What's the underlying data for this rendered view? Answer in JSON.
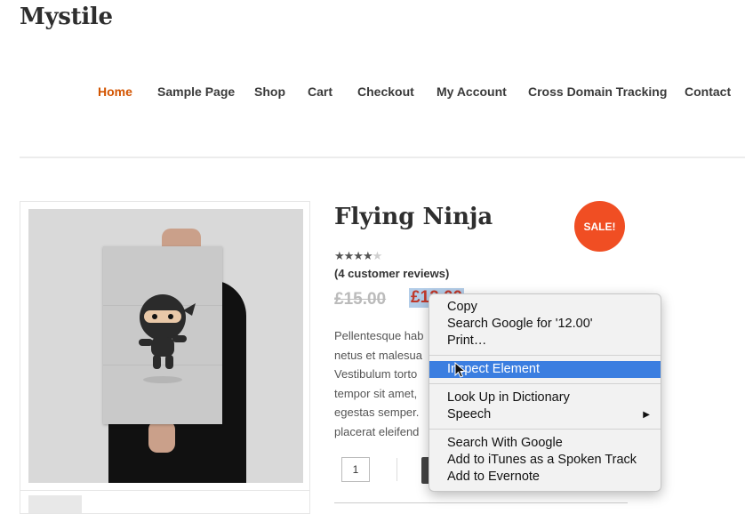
{
  "site": {
    "logo": "Mystile"
  },
  "nav": {
    "items": [
      "Home",
      "Sample Page",
      "Shop",
      "Cart",
      "Checkout",
      "My Account",
      "Cross Domain Tracking",
      "Contact"
    ],
    "active_index": 0
  },
  "product": {
    "title": "Flying Ninja",
    "sale_badge": "SALE!",
    "rating_out_of_5": 4,
    "reviews": "(4 customer reviews)",
    "old_price": "£15.00",
    "new_price": "£12.00",
    "description_lines": [
      "Pellentesque hab",
      "netus et malesua",
      "Vestibulum torto",
      "tempor sit amet,",
      "egestas semper.",
      "placerat eleifend"
    ],
    "quantity": "1"
  },
  "context_menu": {
    "items": [
      "Copy",
      "Search Google for '12.00'",
      "Print…",
      "Inspect Element",
      "Look Up in Dictionary",
      "Speech",
      "Search With Google",
      "Add to iTunes as a Spoken Track",
      "Add to Evernote"
    ],
    "highlighted": "Inspect Element",
    "highlight_color": "#3b7ee0"
  },
  "colors": {
    "accent": "#d35400",
    "sale_badge": "#f04e23",
    "price": "#c0392b"
  }
}
